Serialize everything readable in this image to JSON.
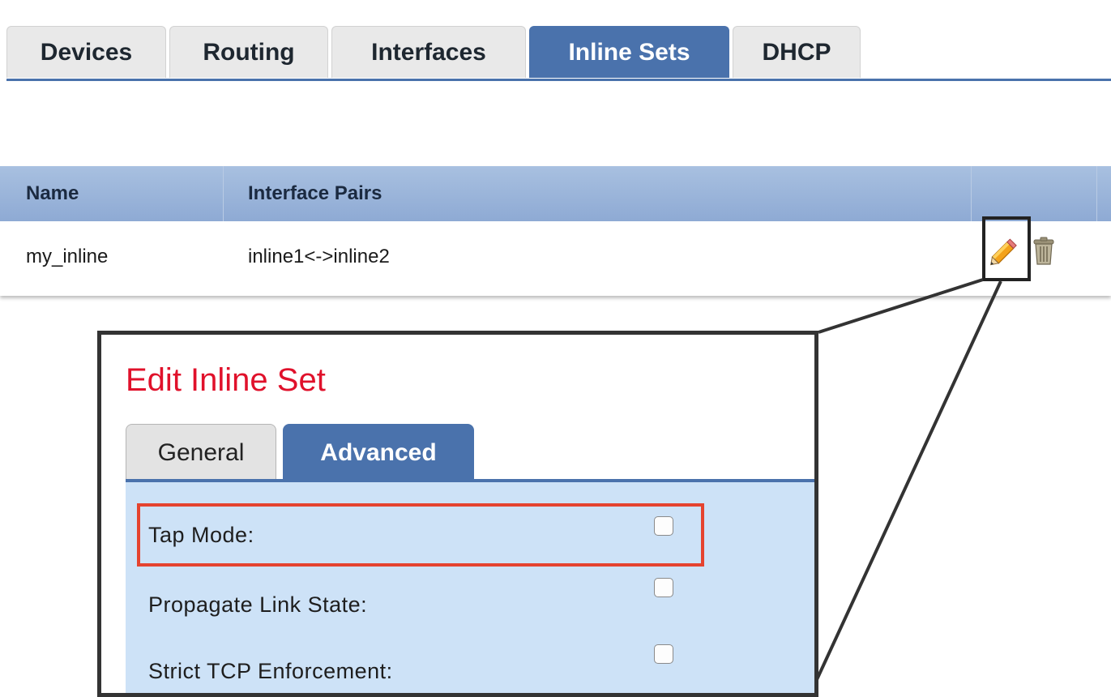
{
  "tabs": [
    {
      "label": "Devices",
      "active": false
    },
    {
      "label": "Routing",
      "active": false
    },
    {
      "label": "Interfaces",
      "active": false
    },
    {
      "label": "Inline Sets",
      "active": true
    },
    {
      "label": "DHCP",
      "active": false
    }
  ],
  "table": {
    "headers": [
      "Name",
      "Interface Pairs"
    ],
    "rows": [
      {
        "name": "my_inline",
        "pairs": "inline1<->inline2",
        "actions": [
          "pencil-icon",
          "trash-icon"
        ]
      }
    ]
  },
  "dialog": {
    "title": "Edit Inline Set",
    "tabs": [
      {
        "label": "General",
        "active": false
      },
      {
        "label": "Advanced",
        "active": true
      }
    ],
    "fields": [
      {
        "label": "Tap Mode:",
        "checked": false,
        "highlighted": true
      },
      {
        "label": "Propagate Link State:",
        "checked": false,
        "highlighted": false
      },
      {
        "label": "Strict TCP Enforcement:",
        "checked": false,
        "highlighted": false
      }
    ]
  },
  "colors": {
    "accent": "#4a72ac",
    "title_red": "#e0112b",
    "highlight_red": "#e5432f",
    "panel_bg": "#cde2f7",
    "table_header": "#8eaad4"
  }
}
